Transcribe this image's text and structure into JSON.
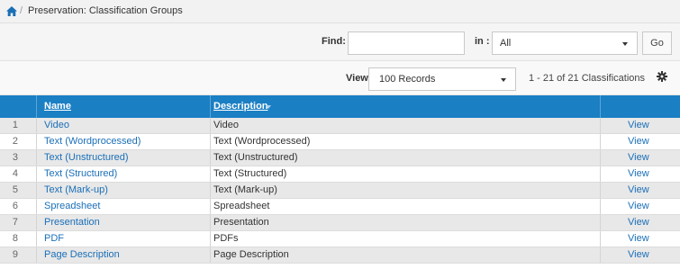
{
  "breadcrumb": {
    "separator": "/",
    "title": "Preservation: Classification Groups"
  },
  "search": {
    "find_label": "Find:",
    "find_value": "",
    "find_placeholder": "",
    "in_label": "in :",
    "in_value": "All",
    "go_label": "Go"
  },
  "view_bar": {
    "view_label": "View",
    "records_value": "100 Records",
    "count_text": "1 - 21 of 21 Classifications"
  },
  "table": {
    "headers": {
      "name": "Name",
      "description": "Description"
    },
    "action_label": "View",
    "rows": [
      {
        "num": "1",
        "name": "Video",
        "description": "Video"
      },
      {
        "num": "2",
        "name": "Text (Wordprocessed)",
        "description": "Text (Wordprocessed)"
      },
      {
        "num": "3",
        "name": "Text (Unstructured)",
        "description": "Text (Unstructured)"
      },
      {
        "num": "4",
        "name": "Text (Structured)",
        "description": "Text (Structured)"
      },
      {
        "num": "5",
        "name": "Text (Mark-up)",
        "description": "Text (Mark-up)"
      },
      {
        "num": "6",
        "name": "Spreadsheet",
        "description": "Spreadsheet"
      },
      {
        "num": "7",
        "name": "Presentation",
        "description": "Presentation"
      },
      {
        "num": "8",
        "name": "PDF",
        "description": "PDFs"
      },
      {
        "num": "9",
        "name": "Page Description",
        "description": "Page Description"
      }
    ]
  },
  "icons": {
    "home": "home-icon",
    "gear": "gear-icon",
    "dropdown": "chevron-down-icon",
    "sort": "sort-desc-icon"
  },
  "colors": {
    "header_bg": "#1b7fc4",
    "link": "#1a6fb8",
    "alt_row": "#e8e8e8"
  }
}
